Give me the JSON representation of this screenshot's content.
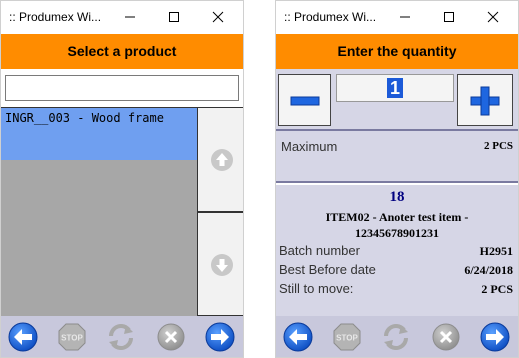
{
  "window1": {
    "title": ":: Produmex Wi...",
    "header": "Select a product",
    "search": {
      "value": "",
      "placeholder": ""
    },
    "list_items": [
      {
        "label": "INGR__003 - Wood frame",
        "selected": true
      }
    ],
    "scroll_icons": [
      "arrow-up-icon",
      "arrow-down-icon"
    ]
  },
  "window2": {
    "title": ":: Produmex Wi...",
    "header": "Enter the quantity",
    "quantity": "1",
    "maximum_label": "Maximum",
    "maximum_value": "2 PCS",
    "item_count": "18",
    "item_name": "ITEM02 - Anoter test item - 12345678901231",
    "details": [
      {
        "label": "Batch number",
        "value": "H2951"
      },
      {
        "label": "Best Before date",
        "value": "6/24/2018"
      },
      {
        "label": "Still to move:",
        "value": "2 PCS"
      }
    ]
  },
  "toolbar_icons": [
    "back-arrow-icon",
    "stop-icon",
    "refresh-icon",
    "cancel-icon",
    "next-arrow-icon"
  ],
  "colors": {
    "header_bg": "#ff8c00",
    "selection": "#6f9ff0",
    "panel_bg": "#d6d6e6",
    "toolbar_bg": "#c8c8dc",
    "icon_blue": "#1e66e0",
    "disabled_icon": "#a9a9a9"
  }
}
